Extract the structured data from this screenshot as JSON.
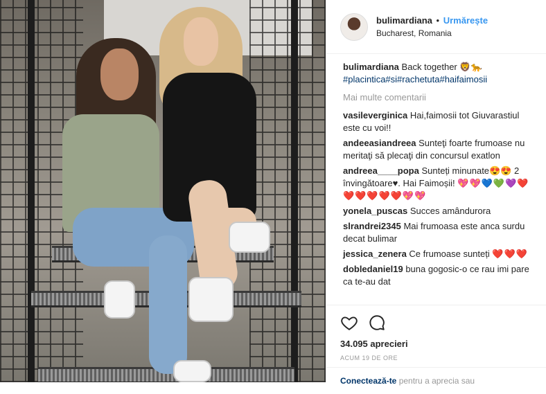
{
  "header": {
    "username": "bulimardiana",
    "separator": "•",
    "follow_label": "Urmărește",
    "location": "Bucharest, Romania",
    "avatar_icon": "profile-avatar"
  },
  "caption": {
    "username": "bulimardiana",
    "text": "Back together 🦁🐆",
    "tags": "#placintica#si#rachetuta#haifaimosii"
  },
  "more_comments_label": "Mai multe comentarii",
  "comments": [
    {
      "user": "vasileverginica",
      "text": "Hai,faimosii tot Giuvarastiul este cu voi!!"
    },
    {
      "user": "andeeasiandreea",
      "text": "Sunteţi foarte frumoase nu meritaţi să plecaţi din concursul exatlon"
    },
    {
      "user": "andreea____popa",
      "text": "Sunteți minunate",
      "emoji": "😍😍",
      "text2": "2 învingătoare",
      "emoji2": "♥. Hai Faimoșii!",
      "hearts": "💖💖💙💚💜❤️❤️❤️❤️❤️❤️💖💖"
    },
    {
      "user": "yonela_puscas",
      "text": "Succes amândurora"
    },
    {
      "user": "slrandrei2345",
      "text": "Mai frumoasa este anca surdu decat bulimar"
    },
    {
      "user": "jessica_zenera",
      "text": "Ce frumoase sunteți",
      "hearts": "❤️❤️❤️"
    },
    {
      "user": "dobledaniel19",
      "text": "buna gogosic-o ce rau imi pare ca te-au dat"
    }
  ],
  "actions": {
    "like_icon": "heart-icon",
    "comment_icon": "comment-icon",
    "likes": "34.095 aprecieri",
    "time": "ACUM 19 DE ORE"
  },
  "login": {
    "link": "Conectează-te",
    "text": "pentru a aprecia sau"
  },
  "colors": {
    "accent": "#3897f0",
    "text": "#262626",
    "muted": "#999999",
    "tag": "#003569"
  }
}
